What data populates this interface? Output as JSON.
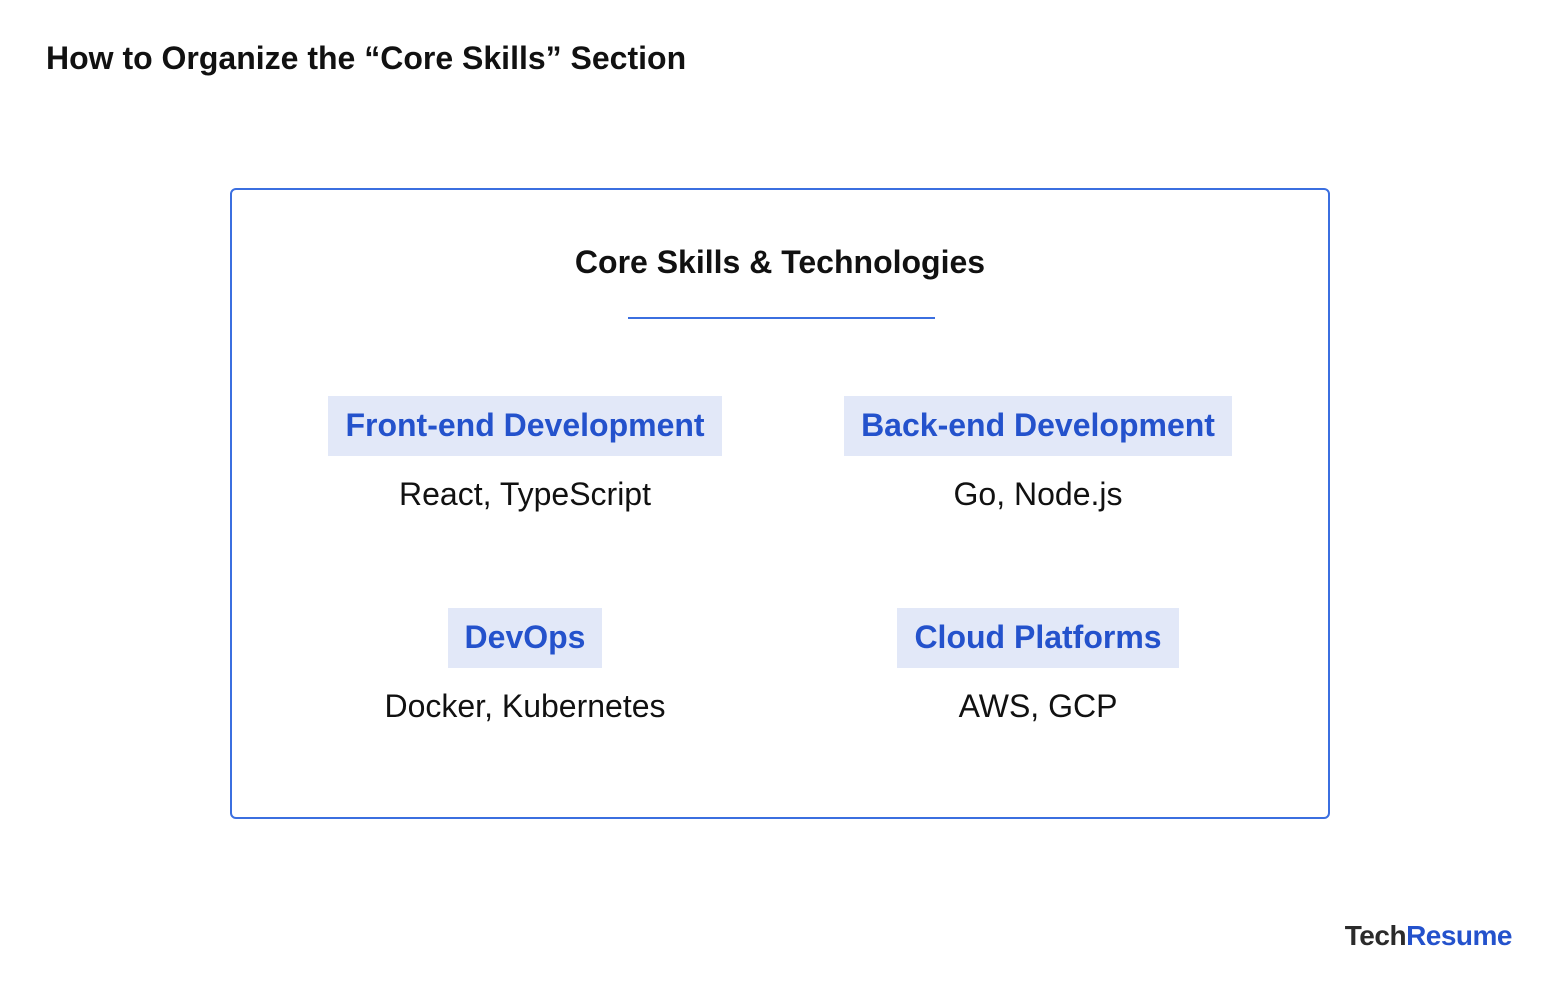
{
  "page_title": "How to Organize the “Core Skills” Section",
  "card": {
    "title": "Core Skills & Technologies",
    "categories": [
      {
        "label": "Front-end Development",
        "items": "React, TypeScript"
      },
      {
        "label": "Back-end Development",
        "items": "Go, Node.js"
      },
      {
        "label": "DevOps",
        "items": "Docker, Kubernetes"
      },
      {
        "label": "Cloud Platforms",
        "items": "AWS, GCP"
      }
    ]
  },
  "brand": {
    "part1": "Tech",
    "part2": "Resume"
  },
  "colors": {
    "accent": "#3b6fe0",
    "label_text": "#2452cc",
    "label_background": "#e2e8f8",
    "text": "#111111"
  }
}
